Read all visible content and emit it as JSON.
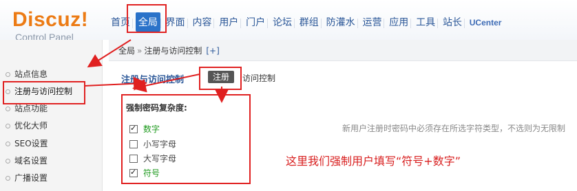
{
  "logo": {
    "title": "Discuz!",
    "subtitle": "Control Panel"
  },
  "nav": {
    "items": [
      "首页",
      "全局",
      "界面",
      "内容",
      "用户",
      "门户",
      "论坛",
      "群组",
      "防灌水",
      "运营",
      "应用",
      "工具",
      "站长",
      "UCenter"
    ],
    "active_index": 1
  },
  "breadcrumb": {
    "root": "全局",
    "sep": "»",
    "current": "注册与访问控制",
    "plus": "[+]"
  },
  "sidebar": {
    "items": [
      "站点信息",
      "注册与访问控制",
      "站点功能",
      "优化大师",
      "SEO设置",
      "域名设置",
      "广播设置"
    ],
    "active_index": 1
  },
  "main": {
    "title": "注册与访问控制",
    "tab_active": "注册",
    "tab_other": "访问控制",
    "section_title": "强制密码复杂度:",
    "options": [
      {
        "label": "数字",
        "checked": true
      },
      {
        "label": "小写字母",
        "checked": false
      },
      {
        "label": "大写字母",
        "checked": false
      },
      {
        "label": "符号",
        "checked": true
      }
    ],
    "hint": "新用户注册时密码中必须存在所选字符类型，不选则为无限制",
    "annotation": "这里我们强制用户填写“符号+数字”"
  },
  "colors": {
    "accent": "#2a72c9",
    "annotation": "#e02020",
    "logo": "#ec7b15",
    "checked_label": "#1e9a1e"
  }
}
